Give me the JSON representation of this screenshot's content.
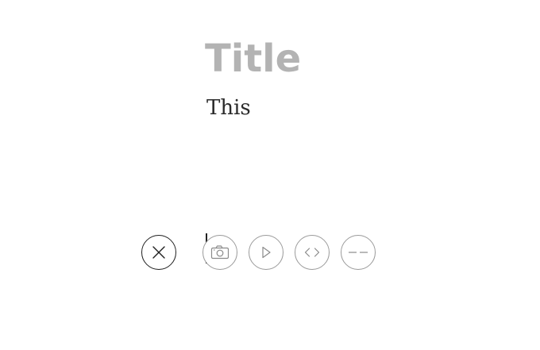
{
  "editor": {
    "title_placeholder": "Title",
    "body_text": "This"
  },
  "inline_toolbar": {
    "close_icon": "close-icon",
    "tools": [
      {
        "icon": "camera-icon"
      },
      {
        "icon": "play-icon"
      },
      {
        "icon": "code-icon"
      },
      {
        "icon": "divider-icon"
      }
    ]
  },
  "colors": {
    "title_placeholder": "#b3b3b3",
    "body_text": "#2b2b2b",
    "tool_border": "#9a9a9a",
    "close_border": "#1f1f1f"
  }
}
